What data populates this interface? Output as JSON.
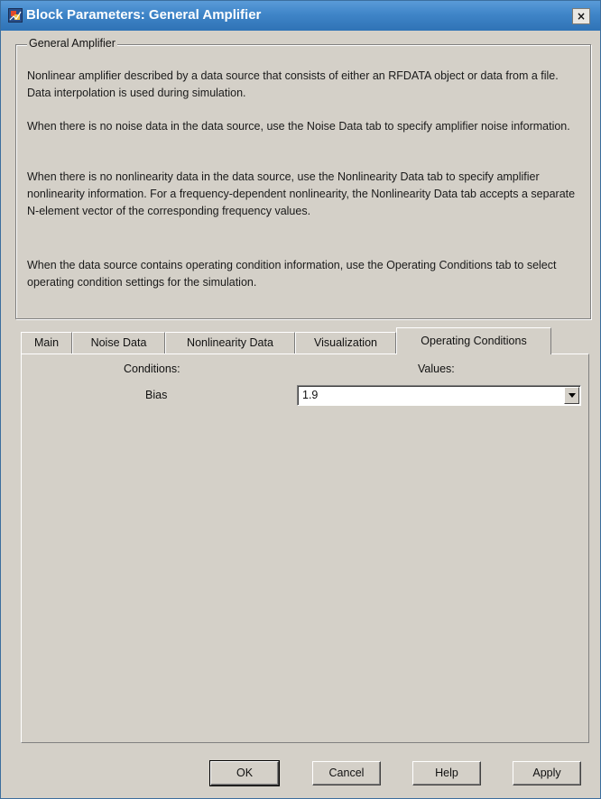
{
  "window": {
    "title": "Block Parameters: General Amplifier",
    "close_label": "×"
  },
  "group": {
    "legend": "General Amplifier",
    "paragraphs": [
      "Nonlinear amplifier described by a data source that consists of either an RFDATA object or data from a file. Data interpolation is used during simulation.",
      "When there is no noise data in the data source, use the Noise Data tab to specify amplifier noise information.",
      "When there is no nonlinearity data in the data source, use the Nonlinearity Data tab to specify amplifier nonlinearity information. For a frequency-dependent nonlinearity, the Nonlinearity Data tab accepts a separate N-element vector of the corresponding frequency values.",
      "When the data source contains operating condition information, use the Operating Conditions tab to select operating condition settings for the simulation."
    ]
  },
  "tabs": [
    {
      "label": "Main"
    },
    {
      "label": "Noise Data"
    },
    {
      "label": "Nonlinearity Data"
    },
    {
      "label": "Visualization"
    },
    {
      "label": "Operating Conditions"
    }
  ],
  "active_tab": "Operating Conditions",
  "conditions": {
    "conditions_header": "Conditions:",
    "values_header": "Values:",
    "rows": [
      {
        "name": "Bias",
        "value": "1.9"
      }
    ]
  },
  "buttons": {
    "ok": "OK",
    "cancel": "Cancel",
    "help": "Help",
    "apply": "Apply"
  },
  "icons": {
    "app": "simulink-block-icon",
    "dropdown": "chevron-down-icon"
  }
}
